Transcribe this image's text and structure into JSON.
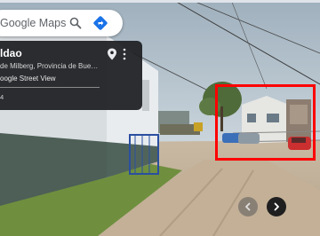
{
  "search": {
    "placeholder": "Google Maps"
  },
  "place": {
    "name": "ldao",
    "address": "de Milberg, Provincia de Buenos ...",
    "source": "oogle Street View",
    "date": "4"
  },
  "icons": {
    "search": "search-icon",
    "directions": "directions-icon",
    "pin": "location-pin-icon",
    "more": "more-vert-icon",
    "prev": "chevron-left-icon",
    "next": "chevron-right-icon"
  },
  "colors": {
    "highlight": "#ff0000",
    "directions_blue": "#1a73e8",
    "card_bg": "#202124"
  }
}
